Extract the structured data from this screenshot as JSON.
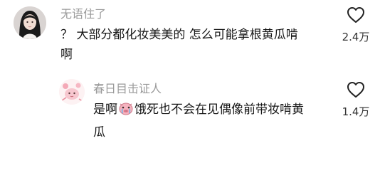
{
  "comments": [
    {
      "username": "无语住了",
      "text_line1": "？ 大部分都化妆美美的  怎么可能拿根黄瓜啃",
      "text_line2": "啊",
      "likes": "2.4万",
      "avatar_icon": "girl-portrait-avatar",
      "like_icon": "heart-outline-icon"
    },
    {
      "username": "春日目击证人",
      "text_prefix": "是啊",
      "emoji_icon": "crying-pig-emoji",
      "text_suffix": "饿死也不会在见偶像前带妆啃黄",
      "text_line2": "瓜",
      "likes": "1.4万",
      "avatar_icon": "pink-cartoon-avatar",
      "like_icon": "heart-outline-icon"
    }
  ],
  "colors": {
    "username": "#9a9a9a",
    "text": "#161616",
    "like_count": "#333333",
    "heart_stroke": "#222222"
  }
}
